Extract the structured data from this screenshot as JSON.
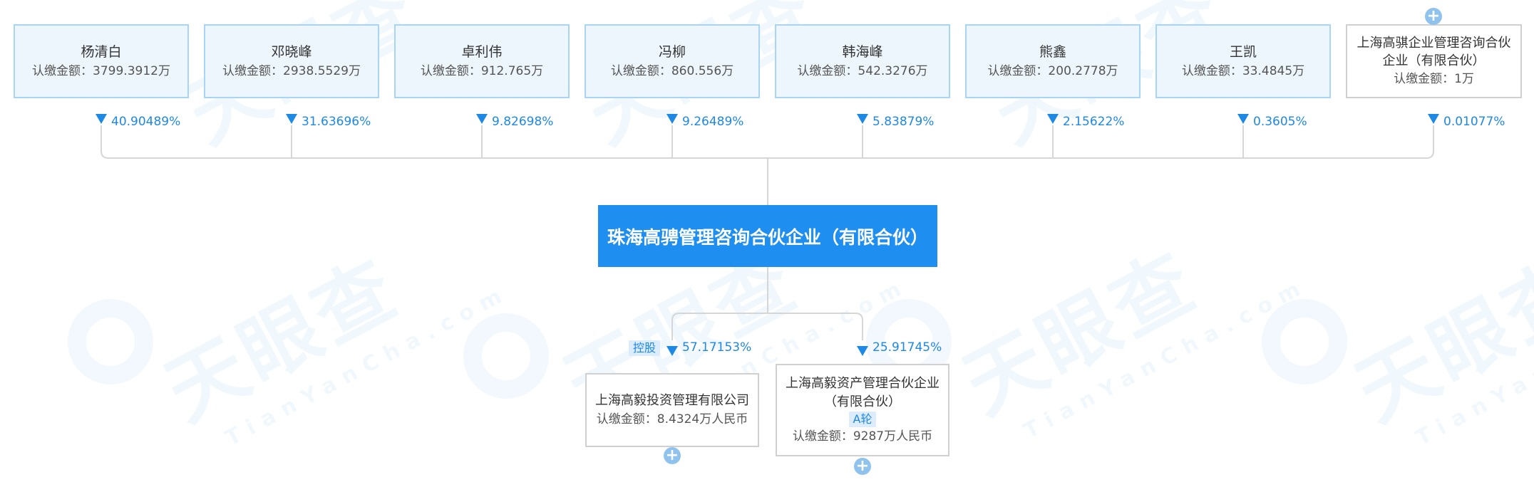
{
  "colors": {
    "accent": "#1e88e5",
    "box_blue_border": "#a8d4f5",
    "box_blue_fill": "#eef6fd",
    "center_fill": "#1e8ef0",
    "line": "#d6d6d6"
  },
  "watermark": {
    "cn": "天眼查",
    "en": "TianYanCha.com"
  },
  "shareholders": [
    {
      "name": "杨清白",
      "amount": "认缴金额：3799.3912万",
      "percent": "40.90489%"
    },
    {
      "name": "邓晓峰",
      "amount": "认缴金额：2938.5529万",
      "percent": "31.63696%"
    },
    {
      "name": "卓利伟",
      "amount": "认缴金额：912.765万",
      "percent": "9.82698%"
    },
    {
      "name": "冯柳",
      "amount": "认缴金额：860.556万",
      "percent": "9.26489%"
    },
    {
      "name": "韩海峰",
      "amount": "认缴金额：542.3276万",
      "percent": "5.83879%"
    },
    {
      "name": "熊鑫",
      "amount": "认缴金额：200.2778万",
      "percent": "2.15622%"
    },
    {
      "name": "王凯",
      "amount": "认缴金额：33.4845万",
      "percent": "0.3605%"
    },
    {
      "name": "上海高骐企业管理咨询合伙企业（有限合伙）",
      "amount": "认缴金额：1万",
      "percent": "0.01077%"
    }
  ],
  "center_company": {
    "name": "珠海高骋管理咨询合伙企业（有限合伙）"
  },
  "investments": [
    {
      "name": "上海高毅投资管理有限公司",
      "amount": "认缴金额：8.4324万人民币",
      "percent": "57.17153%",
      "badge": "控股"
    },
    {
      "name": "上海高毅资产管理合伙企业（有限合伙）",
      "amount": "认缴金额：9287万人民币",
      "percent": "25.91745%",
      "round": "A轮"
    }
  ],
  "expand_icon": "+"
}
